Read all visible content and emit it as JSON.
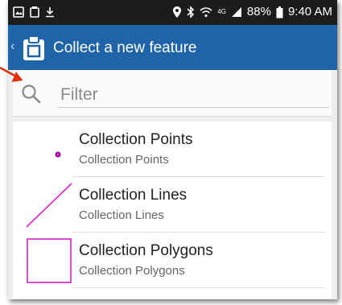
{
  "status_bar": {
    "battery": "88%",
    "time": "9:40 AM",
    "network": "4G"
  },
  "app_bar": {
    "title": "Collect a new feature"
  },
  "filter": {
    "placeholder": "Filter",
    "value": ""
  },
  "feature_types": [
    {
      "title": "Collection Points",
      "subtitle": "Collection Points",
      "geometry": "point-icon"
    },
    {
      "title": "Collection Lines",
      "subtitle": "Collection Lines",
      "geometry": "line-icon"
    },
    {
      "title": "Collection Polygons",
      "subtitle": "Collection Polygons",
      "geometry": "polygon-icon"
    }
  ],
  "colors": {
    "app_bar": "#1f63a8",
    "status_bar": "#1c1c1c",
    "symbol": "#e020c8",
    "annotation_arrow": "#e03010"
  }
}
